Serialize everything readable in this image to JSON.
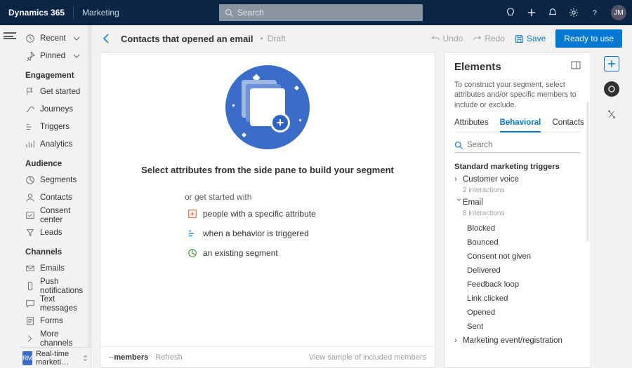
{
  "topbar": {
    "brand": "Dynamics 365",
    "module": "Marketing",
    "search_placeholder": "Search",
    "avatar": "JM"
  },
  "nav": {
    "recent": "Recent",
    "pinned": "Pinned",
    "sections": {
      "engagement": "Engagement",
      "audience": "Audience",
      "channels": "Channels"
    },
    "items": {
      "get_started": "Get started",
      "journeys": "Journeys",
      "triggers": "Triggers",
      "analytics": "Analytics",
      "segments": "Segments",
      "contacts": "Contacts",
      "consent_center": "Consent center",
      "leads": "Leads",
      "emails": "Emails",
      "push": "Push notifications",
      "text": "Text messages",
      "forms": "Forms",
      "more": "More channels"
    },
    "env": {
      "badge": "RM",
      "label": "Real-time marketi…"
    }
  },
  "cmdbar": {
    "title": "Contacts that opened an email",
    "status": "Draft",
    "undo": "Undo",
    "redo": "Redo",
    "save": "Save",
    "primary": "Ready to use"
  },
  "canvas": {
    "headline": "Select attributes from the side pane to build your segment",
    "or": "or get started with",
    "starters": {
      "attribute": "people with a specific attribute",
      "behavior": "when a behavior is triggered",
      "segment": "an existing segment"
    },
    "footer": {
      "members_prefix": "-- ",
      "members": "members",
      "refresh": "Refresh",
      "view": "View sample of included members"
    }
  },
  "panel": {
    "title": "Elements",
    "desc": "To construct your segment, select attributes and/or specific members to include or exclude.",
    "tabs": {
      "attributes": "Attributes",
      "behavioral": "Behavioral",
      "contacts": "Contacts"
    },
    "search_placeholder": "Search",
    "group_title": "Standard marketing triggers",
    "triggers": {
      "customer_voice": {
        "label": "Customer voice",
        "count": "2 interactions"
      },
      "email": {
        "label": "Email",
        "count": "8 interactions",
        "leaves": [
          "Blocked",
          "Bounced",
          "Consent not given",
          "Delivered",
          "Feedback loop",
          "Link clicked",
          "Opened",
          "Sent"
        ]
      },
      "marketing_event": {
        "label": "Marketing event/registration"
      }
    }
  }
}
